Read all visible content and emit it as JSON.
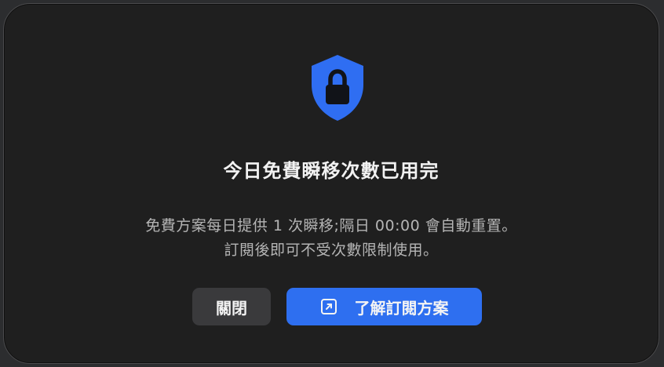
{
  "dialog": {
    "title": "今日免費瞬移次數已用完",
    "message_line1": "免費方案每日提供 1 次瞬移;隔日 00:00 會自動重置。",
    "message_line2": "訂閱後即可不受次數限制使用。",
    "close_label": "關閉",
    "plan_label": "了解訂閱方案",
    "icon": "shield-lock-icon",
    "plan_icon": "external-link-icon"
  },
  "colors": {
    "accent": "#2e6ff0",
    "shield": "#2f6ef2",
    "dialog_bg": "#1f1f1f",
    "secondary_button": "#3a3a3c"
  }
}
